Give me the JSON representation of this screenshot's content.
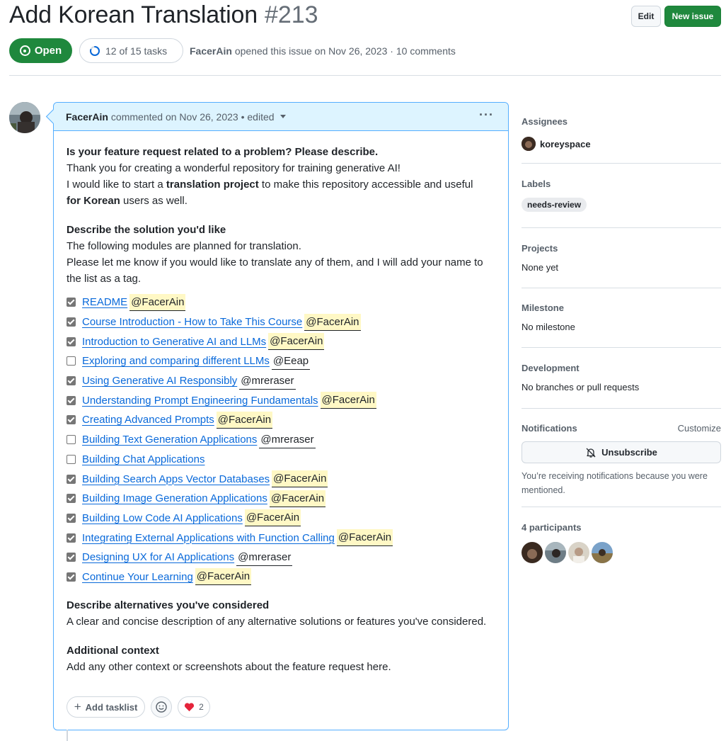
{
  "header": {
    "title": "Add Korean Translation",
    "number": "#213",
    "edit_label": "Edit",
    "new_issue_label": "New issue",
    "state": "Open",
    "tasks_progress": "12 of 15 tasks",
    "tasks_done": 12,
    "tasks_total": 15,
    "author": "FacerAin",
    "meta_rest": "opened this issue on Nov 26, 2023 · 10 comments"
  },
  "comment": {
    "author": "FacerAin",
    "meta": "commented on Nov 26, 2023 • edited",
    "section1_title": "Is your feature request related to a problem? Please describe.",
    "section1_line1": "Thank you for creating a wonderful repository for training generative AI!",
    "section1_line2_pre": "I would like to start a ",
    "section1_line2_bold": "translation project",
    "section1_line2_post": " to make this repository accessible and useful",
    "section1_line3_bold": "for Korean",
    "section1_line3_post": " users as well.",
    "section2_title": "Describe the solution you'd like",
    "section2_line1": "The following modules are planned for translation.",
    "section2_line2": "Please let me know if you would like to translate any of them, and I will add your name to the list as a tag.",
    "tasks": [
      {
        "label": "README",
        "mention": "@FacerAin",
        "checked": true,
        "me": true
      },
      {
        "label": "Course Introduction - How to Take This Course",
        "mention": "@FacerAin",
        "checked": true,
        "me": true
      },
      {
        "label": "Introduction to Generative AI and LLMs",
        "mention": "@FacerAin",
        "checked": true,
        "me": true
      },
      {
        "label": "Exploring and comparing different LLMs",
        "mention": "@Eeap",
        "checked": false,
        "me": false
      },
      {
        "label": "Using Generative AI Responsibly",
        "mention": "@mreraser",
        "checked": true,
        "me": false
      },
      {
        "label": "Understanding Prompt Engineering Fundamentals",
        "mention": "@FacerAin",
        "checked": true,
        "me": true
      },
      {
        "label": "Creating Advanced Prompts",
        "mention": "@FacerAin",
        "checked": true,
        "me": true
      },
      {
        "label": "Building Text Generation Applications",
        "mention": "@mreraser",
        "checked": false,
        "me": false
      },
      {
        "label": "Building Chat Applications",
        "mention": "",
        "checked": false,
        "me": false
      },
      {
        "label": "Building Search Apps Vector Databases",
        "mention": "@FacerAin",
        "checked": true,
        "me": true
      },
      {
        "label": "Building Image Generation Applications",
        "mention": "@FacerAin",
        "checked": true,
        "me": true
      },
      {
        "label": "Building Low Code AI Applications",
        "mention": "@FacerAin",
        "checked": true,
        "me": true
      },
      {
        "label": "Integrating External Applications with Function Calling",
        "mention": "@FacerAin",
        "checked": true,
        "me": true
      },
      {
        "label": "Designing UX for AI Applications",
        "mention": "@mreraser",
        "checked": true,
        "me": false
      },
      {
        "label": "Continue Your Learning",
        "mention": "@FacerAin",
        "checked": true,
        "me": true
      }
    ],
    "section3_title": "Describe alternatives you've considered",
    "section3_line1": "A clear and concise description of any alternative solutions or features you've considered.",
    "section4_title": "Additional context",
    "section4_line1": "Add any other context or screenshots about the feature request here.",
    "add_tasklist_label": "Add tasklist",
    "heart_count": "2"
  },
  "sidebar": {
    "assignees_title": "Assignees",
    "assignee": "koreyspace",
    "labels_title": "Labels",
    "label": "needs-review",
    "projects_title": "Projects",
    "projects_value": "None yet",
    "milestone_title": "Milestone",
    "milestone_value": "No milestone",
    "development_title": "Development",
    "development_value": "No branches or pull requests",
    "notifications_title": "Notifications",
    "customize_label": "Customize",
    "unsubscribe_label": "Unsubscribe",
    "notif_note": "You’re receiving notifications because you were mentioned.",
    "participants_title": "4 participants"
  },
  "colors": {
    "open_green": "#1f883d",
    "link_blue": "#0969da",
    "mention_highlight": "#fff8c5",
    "comment_header_bg": "#ddf4ff"
  },
  "icons": [
    "issue-opened-icon",
    "progress-ring-icon",
    "kebab-icon",
    "chevron-down-icon",
    "plus-icon",
    "smiley-icon",
    "heart-icon",
    "bell-slash-icon"
  ]
}
